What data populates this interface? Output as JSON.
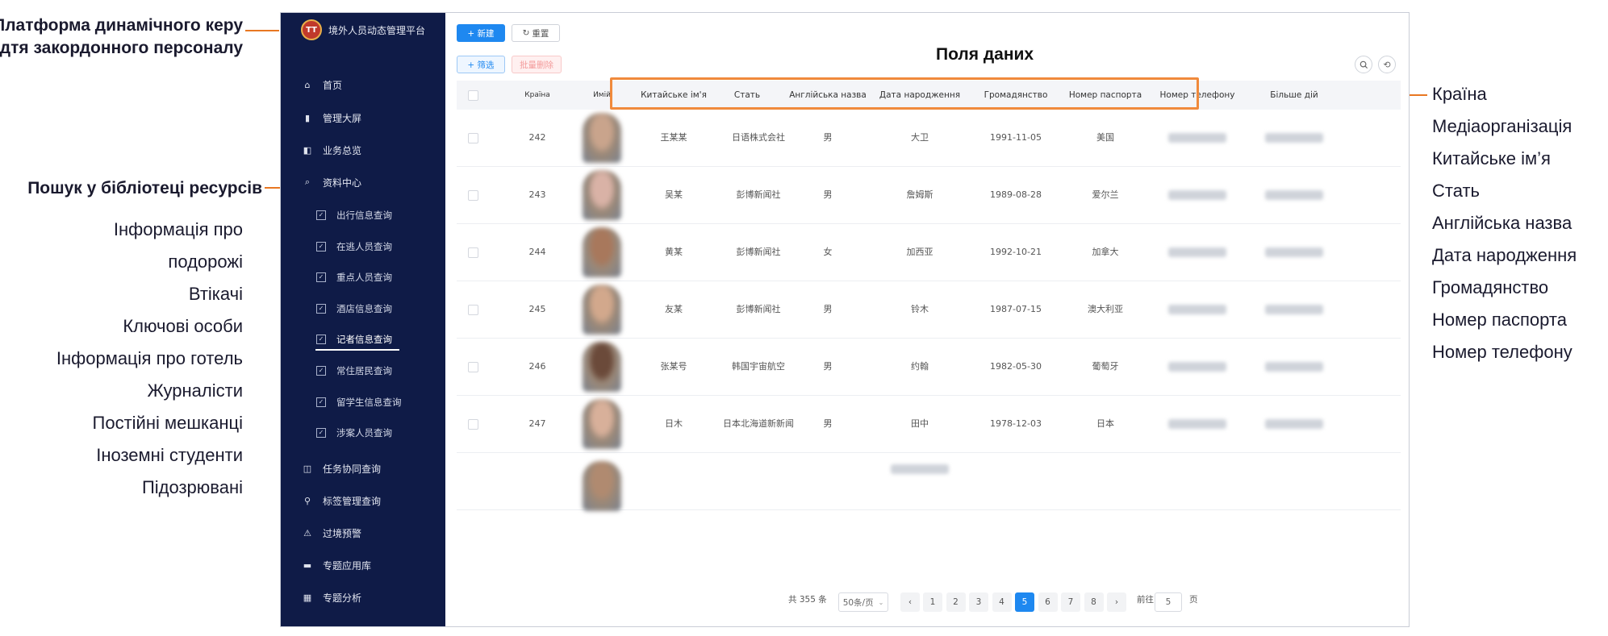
{
  "annotations": {
    "platform": [
      "Платформа динамічного керу",
      "дтя закордонного персоналу"
    ],
    "search_library": "Пошук у бібліотеці ресурсів",
    "left_items": [
      "Інформація про",
      "подорожі",
      "Втікачі",
      "Ключові особи",
      "Інформація про готель",
      "Журналісти",
      "Постійні мешканці",
      "Іноземні студенти",
      "Підозрювані"
    ],
    "fields_title": "Поля даних",
    "right_items": [
      "Країна",
      "Медіаорганізація",
      "Китайське ім’я",
      "Стать",
      "Англійська назва",
      "Дата народження",
      "Громадянство",
      "Номер паспорта",
      "Номер телефону"
    ]
  },
  "app": {
    "title": "境外人员动态管理平台",
    "logo_text": "TT"
  },
  "sidebar": {
    "top_items": [
      {
        "label": "首页",
        "icon": "home-icon"
      },
      {
        "label": "管理大屏",
        "icon": "bar-chart-icon"
      },
      {
        "label": "业务总览",
        "icon": "overview-icon"
      },
      {
        "label": "资料中心",
        "icon": "search-icon"
      }
    ],
    "sub_items": [
      "出行信息查询",
      "在逃人员查询",
      "重点人员查询",
      "酒店信息查询",
      "记者信息查询",
      "常住居民查询",
      "留学生信息查询",
      "涉案人员查询"
    ],
    "active_sub_index": 4,
    "bottom_items": [
      {
        "label": "任务协同查询",
        "icon": "task-icon"
      },
      {
        "label": "标签管理查询",
        "icon": "tag-icon"
      },
      {
        "label": "过境预警",
        "icon": "alert-icon"
      },
      {
        "label": "专题应用库",
        "icon": "library-icon"
      },
      {
        "label": "专题分析",
        "icon": "analysis-icon"
      }
    ]
  },
  "toolbar": {
    "new": "+ 新建",
    "reset": "重置",
    "reset_icon": "↻",
    "filter": "+ 筛选",
    "batch_delete": "批量删除"
  },
  "table": {
    "headers": [
      "Країна",
      "Имiй",
      "Китайське ім'я",
      "Стать",
      "Англійська назва",
      "Дата народження",
      "Громадянство",
      "Номер паспорта",
      "Номер телефону",
      "Більше дій"
    ],
    "rows": [
      {
        "id": "242",
        "chinese_name": "王某某",
        "media": "日语株式会社",
        "gender": "男",
        "english_name": "大卫",
        "birth": "1991-11-05",
        "country": "美国"
      },
      {
        "id": "243",
        "chinese_name": "吴某",
        "media": "彭博新闻社",
        "gender": "男",
        "english_name": "詹姆斯",
        "birth": "1989-08-28",
        "country": "爱尔兰"
      },
      {
        "id": "244",
        "chinese_name": "黄某",
        "media": "彭博新闻社",
        "gender": "女",
        "english_name": "加西亚",
        "birth": "1992-10-21",
        "country": "加拿大"
      },
      {
        "id": "245",
        "chinese_name": "友某",
        "media": "彭博新闻社",
        "gender": "男",
        "english_name": "铃木",
        "birth": "1987-07-15",
        "country": "澳大利亚"
      },
      {
        "id": "246",
        "chinese_name": "张某号",
        "media": "韩国宇宙航空",
        "gender": "男",
        "english_name": "约翰",
        "birth": "1982-05-30",
        "country": "葡萄牙"
      },
      {
        "id": "247",
        "chinese_name": "日木",
        "media": "日本北海道新新闻",
        "gender": "男",
        "english_name": "田中",
        "birth": "1978-12-03",
        "country": "日本"
      }
    ],
    "photo_colors": [
      "#c9a48c",
      "#d9b2a6",
      "#a8785c",
      "#d2a88c",
      "#6b4a3a",
      "#d8b09a",
      "#b08a70"
    ]
  },
  "pagination": {
    "total": "共 355 条",
    "page_size": "50条/页",
    "pages": [
      "1",
      "2",
      "3",
      "4",
      "5",
      "6",
      "7",
      "8"
    ],
    "current": "5",
    "goto_label": "前往",
    "goto_value": "5",
    "goto_suffix": "页",
    "prev": "‹",
    "next": "›"
  },
  "colors": {
    "sidebar_bg": "#0f1b47",
    "accent": "#1e88f0",
    "highlight": "#f08a3c"
  }
}
